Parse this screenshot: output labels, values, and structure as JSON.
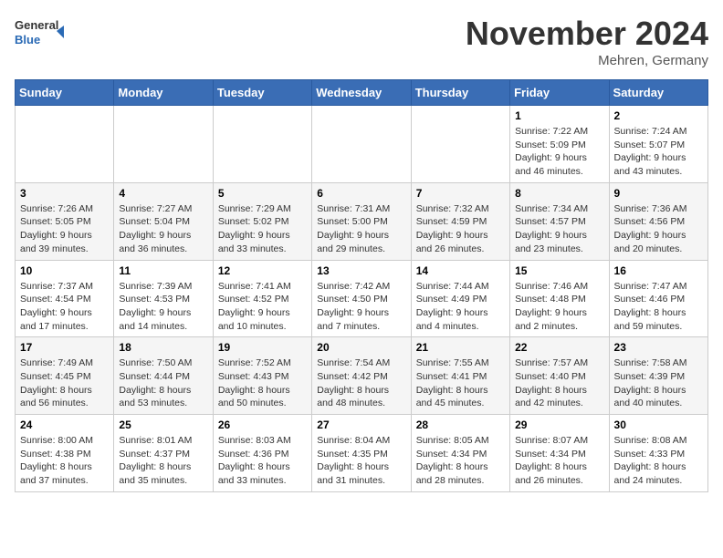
{
  "logo": {
    "text_general": "General",
    "text_blue": "Blue"
  },
  "header": {
    "month_title": "November 2024",
    "location": "Mehren, Germany"
  },
  "days_of_week": [
    "Sunday",
    "Monday",
    "Tuesday",
    "Wednesday",
    "Thursday",
    "Friday",
    "Saturday"
  ],
  "weeks": [
    [
      {
        "day": "",
        "info": ""
      },
      {
        "day": "",
        "info": ""
      },
      {
        "day": "",
        "info": ""
      },
      {
        "day": "",
        "info": ""
      },
      {
        "day": "",
        "info": ""
      },
      {
        "day": "1",
        "info": "Sunrise: 7:22 AM\nSunset: 5:09 PM\nDaylight: 9 hours and 46 minutes."
      },
      {
        "day": "2",
        "info": "Sunrise: 7:24 AM\nSunset: 5:07 PM\nDaylight: 9 hours and 43 minutes."
      }
    ],
    [
      {
        "day": "3",
        "info": "Sunrise: 7:26 AM\nSunset: 5:05 PM\nDaylight: 9 hours and 39 minutes."
      },
      {
        "day": "4",
        "info": "Sunrise: 7:27 AM\nSunset: 5:04 PM\nDaylight: 9 hours and 36 minutes."
      },
      {
        "day": "5",
        "info": "Sunrise: 7:29 AM\nSunset: 5:02 PM\nDaylight: 9 hours and 33 minutes."
      },
      {
        "day": "6",
        "info": "Sunrise: 7:31 AM\nSunset: 5:00 PM\nDaylight: 9 hours and 29 minutes."
      },
      {
        "day": "7",
        "info": "Sunrise: 7:32 AM\nSunset: 4:59 PM\nDaylight: 9 hours and 26 minutes."
      },
      {
        "day": "8",
        "info": "Sunrise: 7:34 AM\nSunset: 4:57 PM\nDaylight: 9 hours and 23 minutes."
      },
      {
        "day": "9",
        "info": "Sunrise: 7:36 AM\nSunset: 4:56 PM\nDaylight: 9 hours and 20 minutes."
      }
    ],
    [
      {
        "day": "10",
        "info": "Sunrise: 7:37 AM\nSunset: 4:54 PM\nDaylight: 9 hours and 17 minutes."
      },
      {
        "day": "11",
        "info": "Sunrise: 7:39 AM\nSunset: 4:53 PM\nDaylight: 9 hours and 14 minutes."
      },
      {
        "day": "12",
        "info": "Sunrise: 7:41 AM\nSunset: 4:52 PM\nDaylight: 9 hours and 10 minutes."
      },
      {
        "day": "13",
        "info": "Sunrise: 7:42 AM\nSunset: 4:50 PM\nDaylight: 9 hours and 7 minutes."
      },
      {
        "day": "14",
        "info": "Sunrise: 7:44 AM\nSunset: 4:49 PM\nDaylight: 9 hours and 4 minutes."
      },
      {
        "day": "15",
        "info": "Sunrise: 7:46 AM\nSunset: 4:48 PM\nDaylight: 9 hours and 2 minutes."
      },
      {
        "day": "16",
        "info": "Sunrise: 7:47 AM\nSunset: 4:46 PM\nDaylight: 8 hours and 59 minutes."
      }
    ],
    [
      {
        "day": "17",
        "info": "Sunrise: 7:49 AM\nSunset: 4:45 PM\nDaylight: 8 hours and 56 minutes."
      },
      {
        "day": "18",
        "info": "Sunrise: 7:50 AM\nSunset: 4:44 PM\nDaylight: 8 hours and 53 minutes."
      },
      {
        "day": "19",
        "info": "Sunrise: 7:52 AM\nSunset: 4:43 PM\nDaylight: 8 hours and 50 minutes."
      },
      {
        "day": "20",
        "info": "Sunrise: 7:54 AM\nSunset: 4:42 PM\nDaylight: 8 hours and 48 minutes."
      },
      {
        "day": "21",
        "info": "Sunrise: 7:55 AM\nSunset: 4:41 PM\nDaylight: 8 hours and 45 minutes."
      },
      {
        "day": "22",
        "info": "Sunrise: 7:57 AM\nSunset: 4:40 PM\nDaylight: 8 hours and 42 minutes."
      },
      {
        "day": "23",
        "info": "Sunrise: 7:58 AM\nSunset: 4:39 PM\nDaylight: 8 hours and 40 minutes."
      }
    ],
    [
      {
        "day": "24",
        "info": "Sunrise: 8:00 AM\nSunset: 4:38 PM\nDaylight: 8 hours and 37 minutes."
      },
      {
        "day": "25",
        "info": "Sunrise: 8:01 AM\nSunset: 4:37 PM\nDaylight: 8 hours and 35 minutes."
      },
      {
        "day": "26",
        "info": "Sunrise: 8:03 AM\nSunset: 4:36 PM\nDaylight: 8 hours and 33 minutes."
      },
      {
        "day": "27",
        "info": "Sunrise: 8:04 AM\nSunset: 4:35 PM\nDaylight: 8 hours and 31 minutes."
      },
      {
        "day": "28",
        "info": "Sunrise: 8:05 AM\nSunset: 4:34 PM\nDaylight: 8 hours and 28 minutes."
      },
      {
        "day": "29",
        "info": "Sunrise: 8:07 AM\nSunset: 4:34 PM\nDaylight: 8 hours and 26 minutes."
      },
      {
        "day": "30",
        "info": "Sunrise: 8:08 AM\nSunset: 4:33 PM\nDaylight: 8 hours and 24 minutes."
      }
    ]
  ]
}
